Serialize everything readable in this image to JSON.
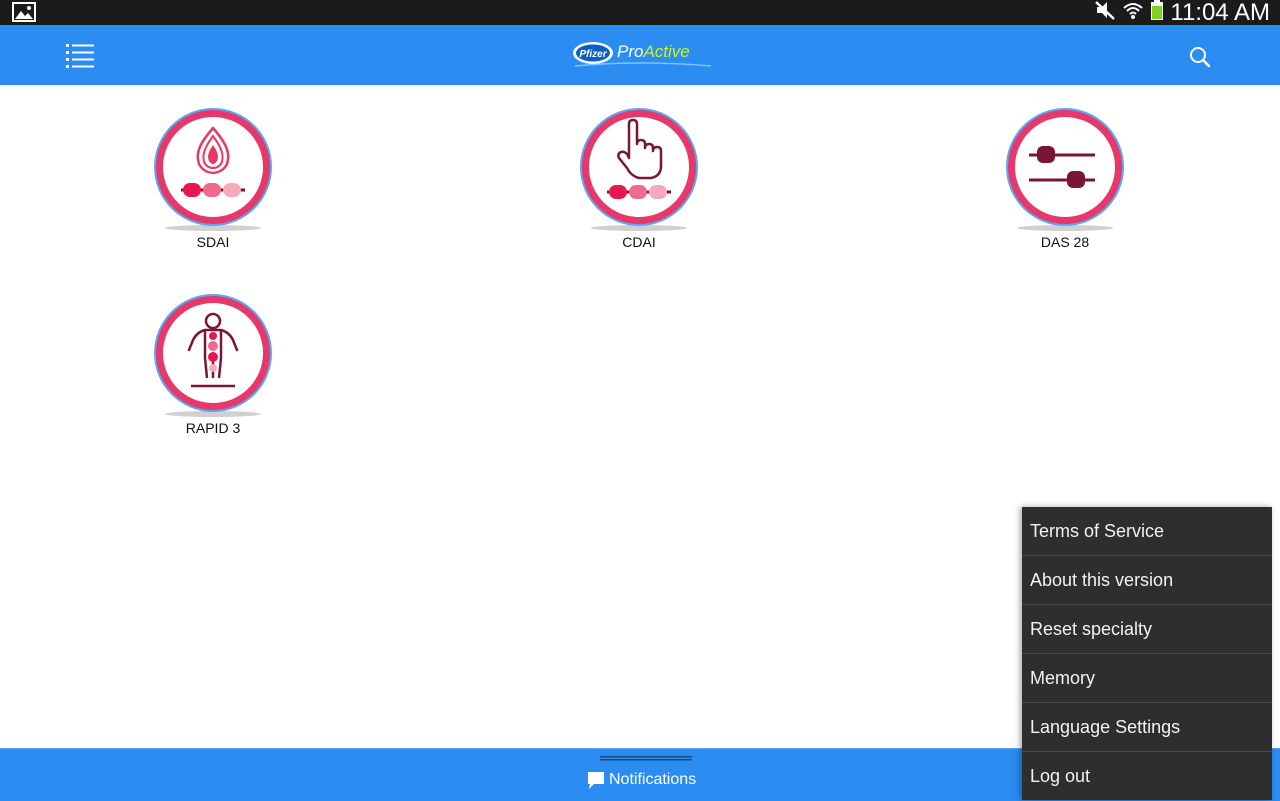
{
  "status_bar": {
    "time": "11:04 AM",
    "icons": [
      "gallery-icon",
      "mute-icon",
      "wifi-icon",
      "battery-icon"
    ]
  },
  "app_bar": {
    "brand": "Pfizer",
    "title_part1": "Pro",
    "title_part2": "Active",
    "icons": [
      "menu-icon",
      "search-icon"
    ]
  },
  "tiles": [
    {
      "label": "SDAI",
      "icon": "blood-drop-slider-icon"
    },
    {
      "label": "CDAI",
      "icon": "finger-touch-slider-icon"
    },
    {
      "label": "DAS 28",
      "icon": "sliders-icon"
    },
    {
      "label": "RAPID 3",
      "icon": "body-joints-icon"
    }
  ],
  "bottom_bar": {
    "notifications_label": "Notifications",
    "icon": "chat-bubble-icon"
  },
  "overflow_menu": {
    "items": [
      "Terms of Service",
      "About this version",
      "Reset specialty",
      "Memory",
      "Language Settings",
      "Log out"
    ]
  },
  "colors": {
    "app_bar": "#2b8cf2",
    "status_bar": "#1b1b1b",
    "tile_ring": "#e6396a",
    "tile_ring_outer": "#5aa6f5",
    "icon_dark": "#7a1535",
    "logo_accent": "#c9f227",
    "menu_bg": "#2e2e2e"
  }
}
